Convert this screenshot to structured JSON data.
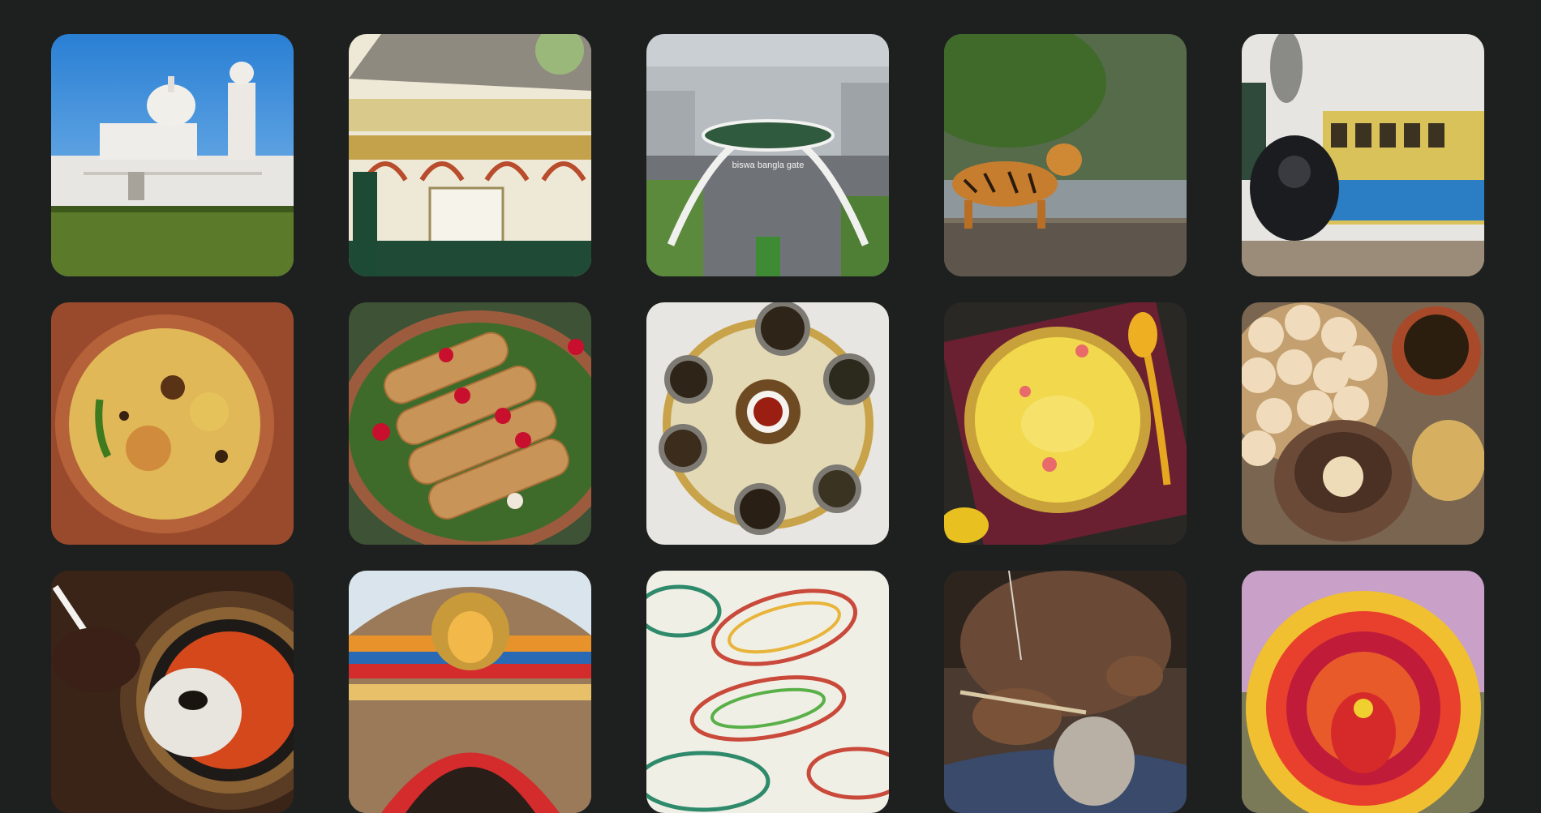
{
  "gallery": {
    "tiles": [
      {
        "subject": "victoria-memorial"
      },
      {
        "subject": "ornate-pavilion"
      },
      {
        "subject": "biswa-bangla-gate",
        "sign_text": "biswa bangla gate"
      },
      {
        "subject": "bengal-tiger-sundarbans"
      },
      {
        "subject": "darjeeling-toy-train"
      },
      {
        "subject": "biryani-clay-bowl"
      },
      {
        "subject": "patishapta-crepes"
      },
      {
        "subject": "tea-leaves-platter"
      },
      {
        "subject": "payesh-dessert"
      },
      {
        "subject": "phuchka-street-food"
      },
      {
        "subject": "durga-idol-painting"
      },
      {
        "subject": "durga-puja-pandal"
      },
      {
        "subject": "kantha-embroidery-fish"
      },
      {
        "subject": "clay-idol-sculpting"
      },
      {
        "subject": "chhau-mask"
      }
    ]
  },
  "colors": {
    "background": "#1e201f"
  }
}
